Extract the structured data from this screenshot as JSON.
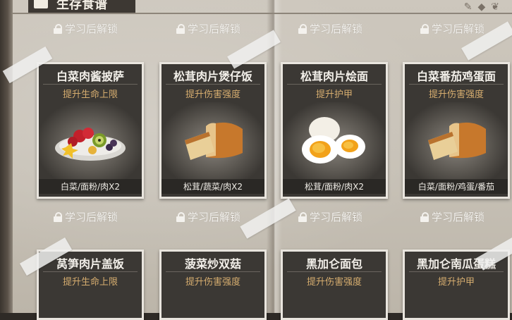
{
  "header": {
    "title": "生存食谱"
  },
  "lock_text": "学习后解锁",
  "top_locks": [
    "学习后解锁",
    "学习后解锁",
    "学习后解锁",
    "学习后解锁"
  ],
  "middle_locks": [
    "学习后解锁",
    "学习后解锁",
    "学习后解锁",
    "学习后解锁"
  ],
  "recipes_row1": [
    {
      "name": "白菜肉酱披萨",
      "effect": "提升生命上限",
      "ingredients": "白菜/面粉/肉X2",
      "image": "fruit-plate-icon"
    },
    {
      "name": "松茸肉片煲仔饭",
      "effect": "提升伤害强度",
      "ingredients": "松茸/蔬菜/肉X2",
      "image": "bread-icon"
    },
    {
      "name": "松茸肉片烩面",
      "effect": "提升护甲",
      "ingredients": "松茸/面粉/肉X2",
      "image": "boiled-egg-icon"
    },
    {
      "name": "白菜番茄鸡蛋面",
      "effect": "提升伤害强度",
      "ingredients": "白菜/面粉/鸡蛋/番茄",
      "image": "bread-icon"
    }
  ],
  "recipes_row2": [
    {
      "name": "莴笋肉片盖饭",
      "effect": "提升生命上限"
    },
    {
      "name": "菠菜炒双菇",
      "effect": "提升伤害强度"
    },
    {
      "name": "黑加仑面包",
      "effect": "提升伤害强度"
    },
    {
      "name": "黑加仑南瓜蛋糕",
      "effect": "提升护甲"
    }
  ],
  "colors": {
    "card_bg": "#3b3834",
    "effect_text": "#d6ad6f",
    "page": "#c9c3b8"
  }
}
